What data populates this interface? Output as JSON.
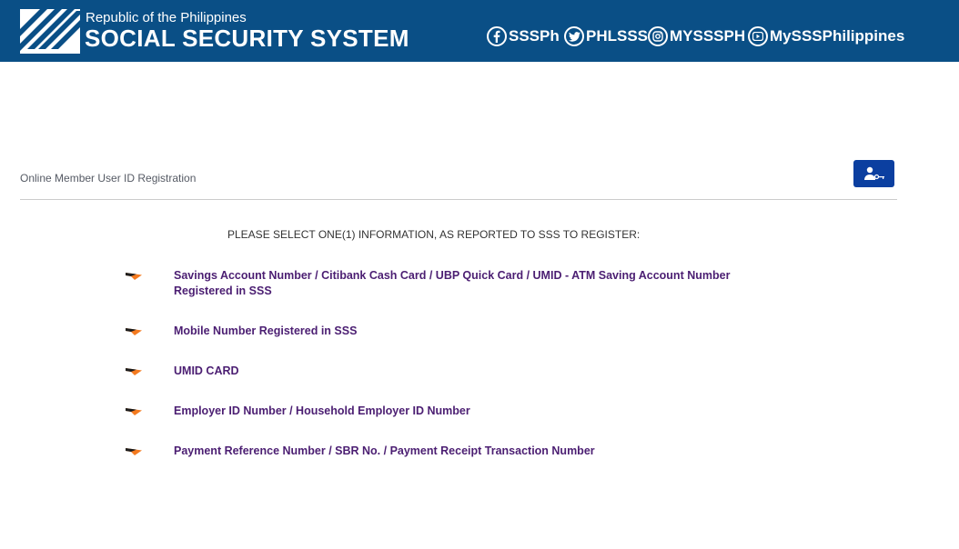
{
  "header": {
    "subtitle": "Republic of the Philippines",
    "title": "SOCIAL SECURITY SYSTEM",
    "social": [
      {
        "icon": "facebook-icon",
        "label": "SSSPh"
      },
      {
        "icon": "twitter-icon",
        "label": "PHLSSS"
      },
      {
        "icon": "instagram-icon",
        "label": "MYSSSPH"
      },
      {
        "icon": "youtube-icon",
        "label": "MySSSPhilippines"
      }
    ]
  },
  "page": {
    "section_title": "Online Member User ID Registration",
    "user_button_icon": "user-key-icon",
    "instruction": "PLEASE SELECT ONE(1) INFORMATION, AS REPORTED TO SSS TO REGISTER:"
  },
  "options": [
    {
      "line1": "Savings Account Number / Citibank Cash Card / UBP Quick Card / UMID - ATM Saving Account Number",
      "line2": "Registered in SSS"
    },
    {
      "line1": "Mobile Number Registered in SSS"
    },
    {
      "line1": "UMID CARD"
    },
    {
      "line1": "Employer ID Number / Household Employer ID Number"
    },
    {
      "line1": "Payment Reference Number / SBR No. / Payment Receipt Transaction Number"
    }
  ],
  "colors": {
    "header_bg": "#0a4f86",
    "link": "#4b1e72",
    "arrow_orange": "#f47a1f",
    "button_bg": "#0b3fa0"
  }
}
